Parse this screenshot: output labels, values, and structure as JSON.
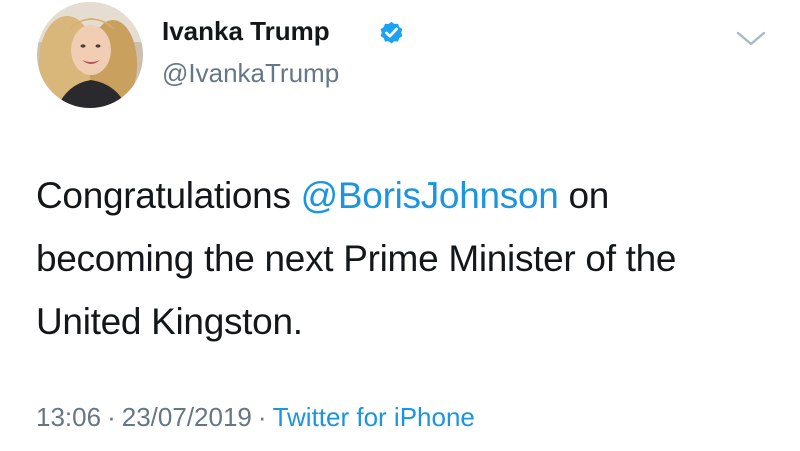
{
  "tweet": {
    "author": {
      "display_name": "Ivanka Trump",
      "handle": "@IvankaTrump",
      "verified": true
    },
    "text": {
      "before": "Congratulations ",
      "mention": "@BorisJohnson",
      "after": " on becoming the next Prime Minister of the United Kingston."
    },
    "time": "13:06",
    "date": "23/07/2019",
    "source": "Twitter for iPhone",
    "separator": "·"
  },
  "icons": {
    "verified": "verified-badge-icon",
    "menu": "chevron-down-icon"
  },
  "colors": {
    "text": "#14171a",
    "secondary": "#657786",
    "link": "#1b95e0",
    "background": "#ffffff"
  }
}
